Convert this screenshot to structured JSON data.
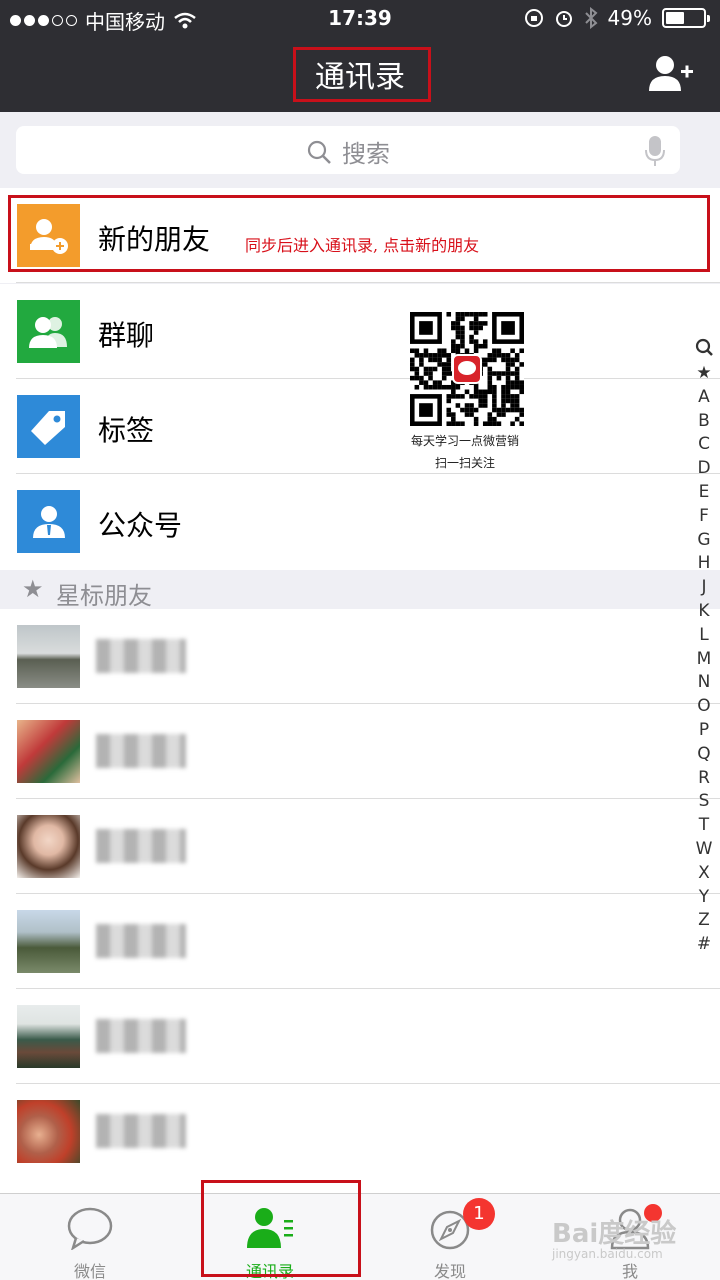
{
  "status_bar": {
    "carrier": "中国移动",
    "time": "17:39",
    "battery": "49%",
    "battery_level": 0.49
  },
  "nav": {
    "title": "通讯录"
  },
  "search": {
    "placeholder": "搜索"
  },
  "menu_items": [
    {
      "label": "新的朋友",
      "icon": "add-friend-icon",
      "color": "#f39c2c"
    },
    {
      "label": "群聊",
      "icon": "group-icon",
      "color": "#22a93f"
    },
    {
      "label": "标签",
      "icon": "tag-icon",
      "color": "#2e8ad8"
    },
    {
      "label": "公众号",
      "icon": "official-account-icon",
      "color": "#2e8ad8"
    }
  ],
  "annotation": "同步后进入通讯录, 点击新的朋友",
  "starred_section": {
    "star": "★",
    "title": "星标朋友"
  },
  "qr": {
    "caption1": "每天学习一点微营销",
    "caption2": "扫一扫关注"
  },
  "index": [
    "★",
    "A",
    "B",
    "C",
    "D",
    "E",
    "F",
    "G",
    "H",
    "J",
    "K",
    "L",
    "M",
    "N",
    "O",
    "P",
    "Q",
    "R",
    "S",
    "T",
    "W",
    "X",
    "Y",
    "Z",
    "#"
  ],
  "tabs": [
    {
      "label": "微信",
      "icon": "chat-bubble-icon",
      "active": false
    },
    {
      "label": "通讯录",
      "icon": "contacts-icon",
      "active": true
    },
    {
      "label": "发现",
      "icon": "compass-icon",
      "active": false,
      "badge": "1"
    },
    {
      "label": "我",
      "icon": "person-icon",
      "active": false
    }
  ],
  "watermark": {
    "text": "Bai度经验",
    "sub": "jingyan.baidu.com"
  },
  "colors": {
    "accent_green": "#1aad19",
    "nav_bg": "#2e2e33",
    "highlight_red": "#c8101a"
  }
}
